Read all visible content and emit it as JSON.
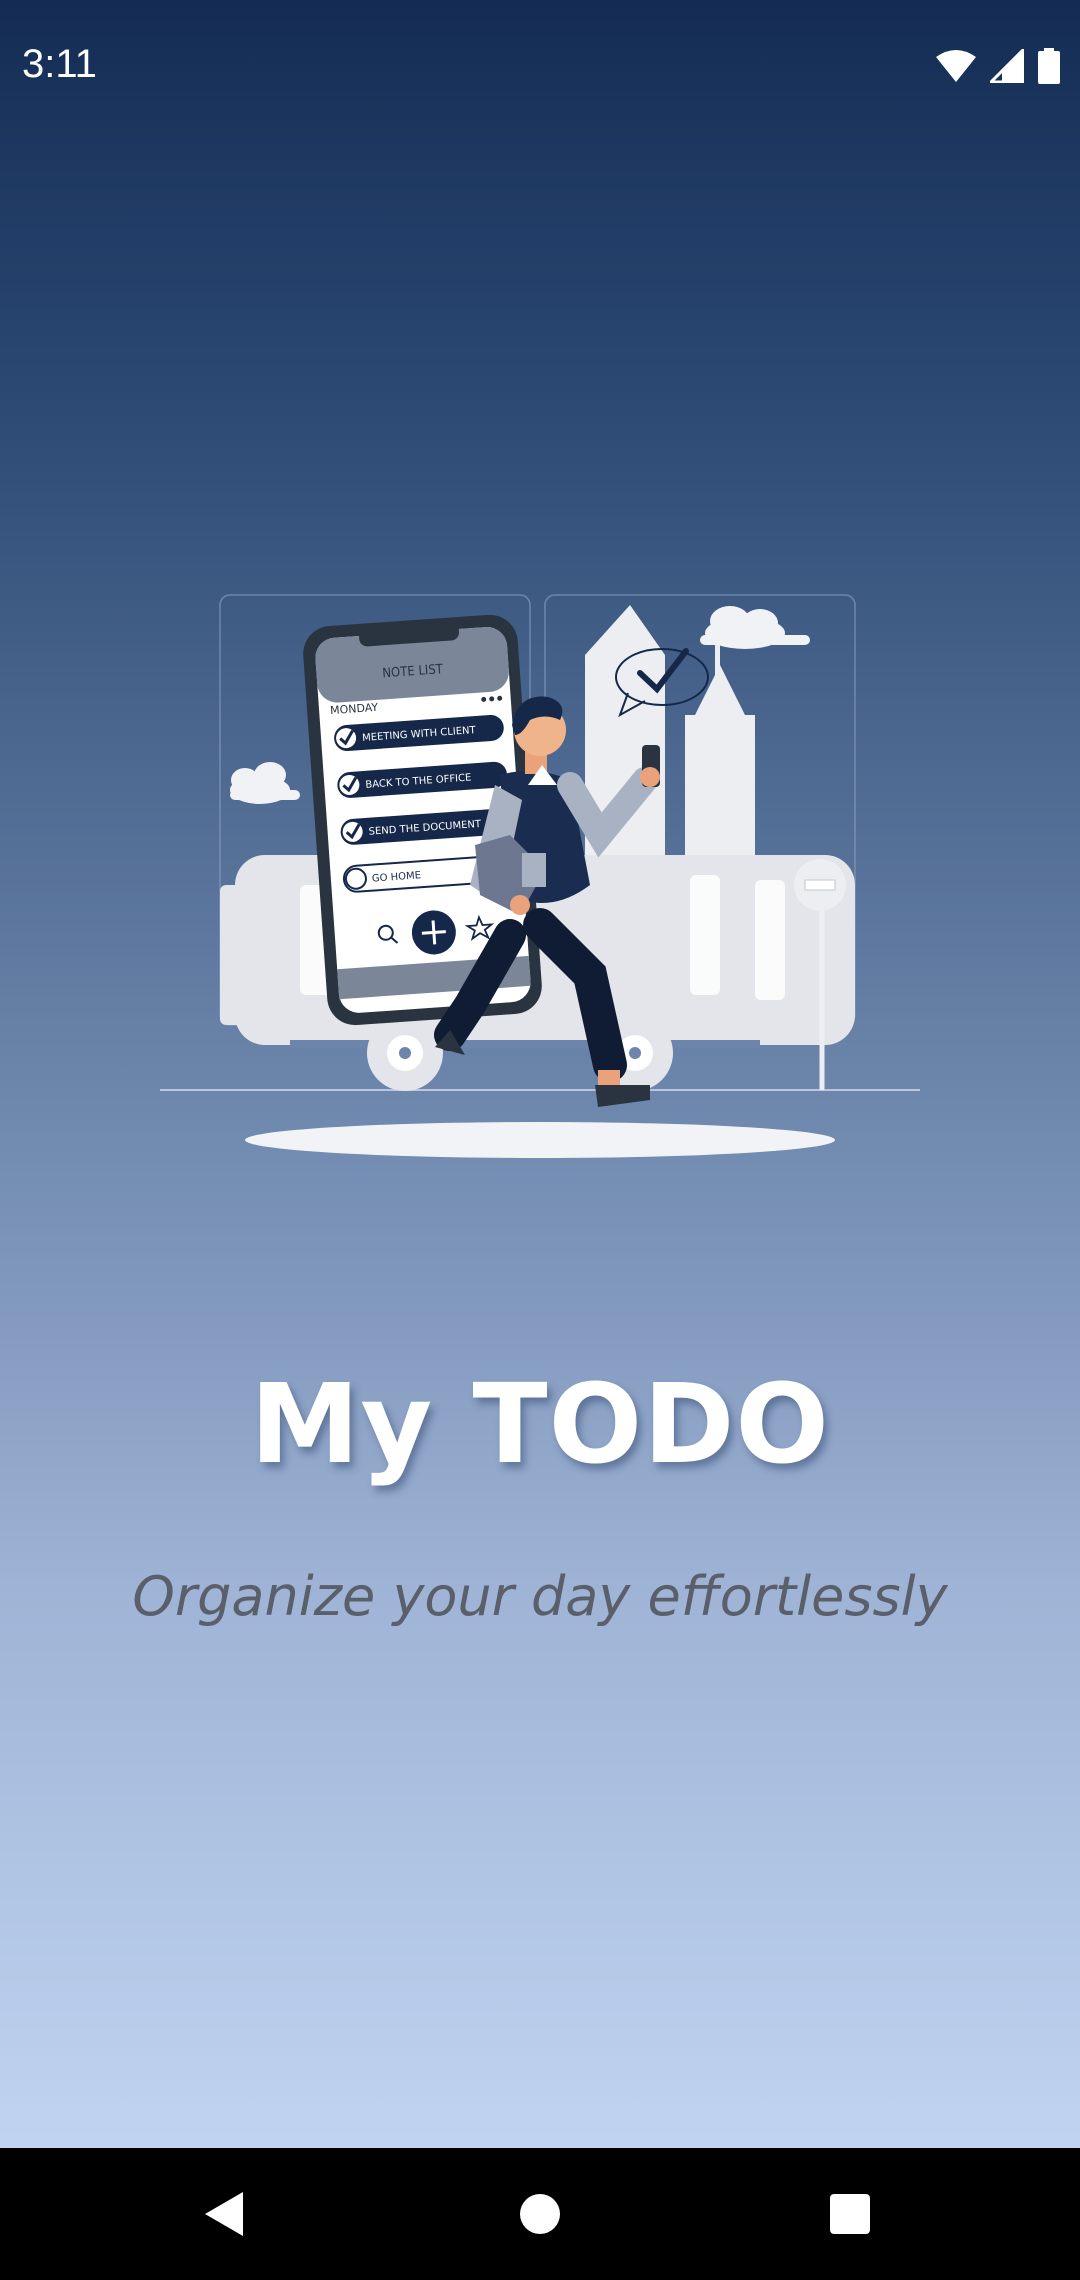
{
  "status_bar": {
    "time": "3:11",
    "icons": [
      "wifi-icon",
      "signal-icon",
      "battery-icon"
    ]
  },
  "illustration": {
    "phone_screen": {
      "header": "NOTE LIST",
      "day": "MONDAY",
      "tasks": [
        {
          "label": "MEETING WITH CLIENT",
          "done": true
        },
        {
          "label": "BACK TO THE OFFICE",
          "done": true
        },
        {
          "label": "SEND THE DOCUMENT",
          "done": true
        },
        {
          "label": "GO HOME",
          "done": false
        }
      ],
      "bottom_icons": [
        "search-icon",
        "add-icon",
        "star-icon"
      ]
    }
  },
  "app": {
    "title": "My TODO",
    "subtitle": "Organize your day effortlessly"
  },
  "nav_bar": {
    "buttons": [
      "back-icon",
      "home-icon",
      "recents-icon"
    ]
  },
  "colors": {
    "gradient_top": "#142c54",
    "gradient_bottom": "#c9dbf7",
    "accent_navy": "#1a2c50",
    "title_text": "#ffffff",
    "subtitle_text": "#5a5f6a"
  }
}
